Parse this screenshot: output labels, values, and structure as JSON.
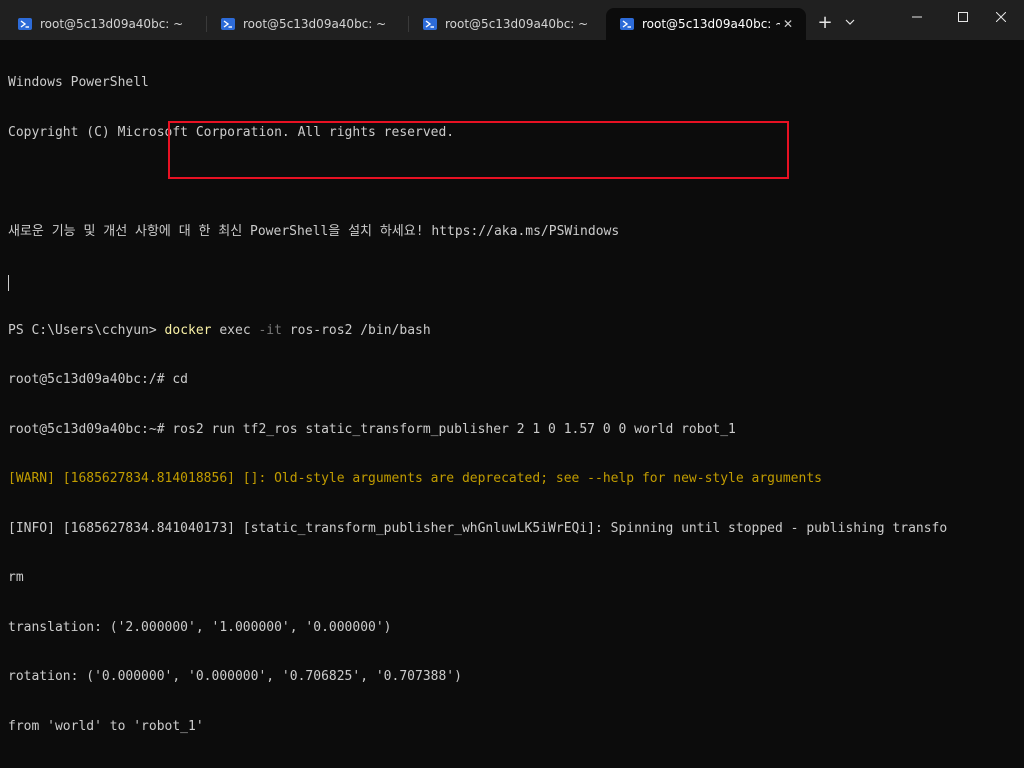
{
  "tabs": [
    {
      "title": "root@5c13d09a40bc: ~",
      "active": false
    },
    {
      "title": "root@5c13d09a40bc: ~",
      "active": false
    },
    {
      "title": "root@5c13d09a40bc: ~",
      "active": false
    },
    {
      "title": "root@5c13d09a40bc: ~",
      "active": true
    }
  ],
  "titlebar": {
    "new_tab": "+",
    "dropdown": "⌄"
  },
  "window_controls": {
    "minimize": "—",
    "maximize": "☐",
    "close": "✕"
  },
  "terminal": {
    "lines": [
      "Windows PowerShell",
      "Copyright (C) Microsoft Corporation. All rights reserved.",
      "",
      "새로운 기능 및 개선 사항에 대 한 최신 PowerShell을 설치 하세요! https://aka.ms/PSWindows",
      "",
      "PS C:\\Users\\cchyun> ",
      "root@5c13d09a40bc:/# cd",
      "root@5c13d09a40bc:~# ros2 run tf2_ros static_transform_publisher 2 1 0 1.57 0 0 world robot_1",
      "[WARN] [1685627834.814018856] []: Old-style arguments are deprecated; see --help for new-style arguments",
      "[INFO] [1685627834.841040173] [static_transform_publisher_whGnluwLK5iWrEQi]: Spinning until stopped - publishing transfo",
      "rm",
      "translation: ('2.000000', '1.000000', '0.000000')",
      "rotation: ('0.000000', '0.000000', '0.706825', '0.707388')",
      "from 'world' to 'robot_1'"
    ],
    "ps_command": {
      "program": "docker",
      "arg1": " exec ",
      "flag": "-it",
      "rest": " ros-ros2 /bin/bash"
    }
  },
  "colors": {
    "background": "#0c0c0c",
    "text": "#cccccc",
    "warn": "#c19c00",
    "command": "#f9f1a5",
    "highlight_border": "#e81123"
  }
}
